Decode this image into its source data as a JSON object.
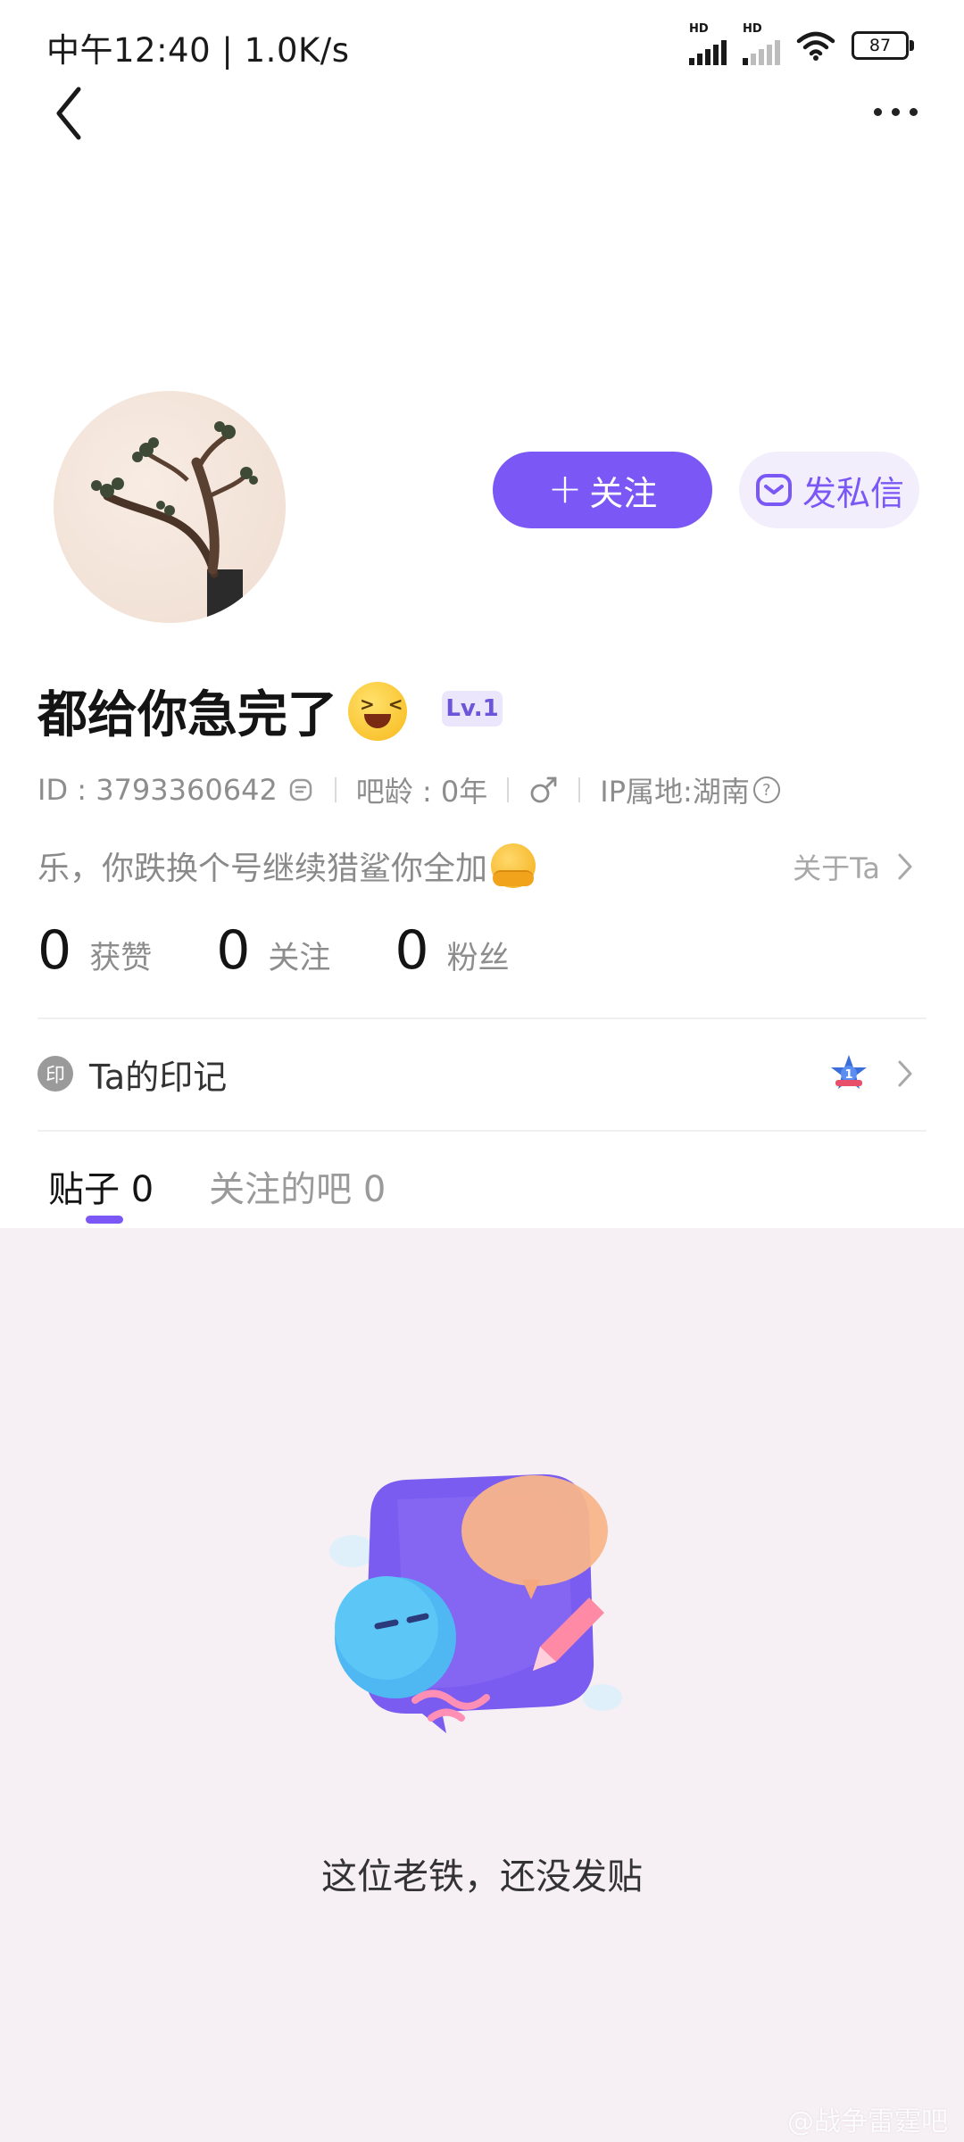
{
  "status_bar": {
    "time": "中午12:40",
    "speed": "1.0K/s",
    "signal_label_1": "HD",
    "signal_label_2": "HD",
    "battery": "87"
  },
  "nav": {
    "back_icon": "chevron-left-icon",
    "more_icon": "more-horizontal-icon"
  },
  "profile": {
    "follow_plus": "+",
    "follow_label": "关注",
    "message_label": "发私信",
    "username": "都给你急完了",
    "username_emoji": "laughing-emoji",
    "level": "Lv.1",
    "id_text": "ID : 3793360642",
    "bar_age": "吧龄 : 0年",
    "gender_icon": "male-icon",
    "ip_location": "IP属地:湖南",
    "help_mark": "?",
    "bio": "乐，你跌换个号继续猎鲨你全加",
    "bio_emoji": "hugging-emoji",
    "about_label": "关于Ta"
  },
  "stats": [
    {
      "num": "0",
      "label": "获赞"
    },
    {
      "num": "0",
      "label": "关注"
    },
    {
      "num": "0",
      "label": "粉丝"
    }
  ],
  "seal": {
    "icon_text": "印",
    "label": "Ta的印记",
    "badge_icon": "star-badge-icon",
    "badge_text": "1"
  },
  "tabs": [
    {
      "label": "贴子",
      "count": "0",
      "active": true
    },
    {
      "label": "关注的吧",
      "count": "0",
      "active": false
    }
  ],
  "empty_state": {
    "message": "这位老铁，还没发贴",
    "illustration": "empty-posts-illustration"
  },
  "watermark": "@战争雷霆吧",
  "colors": {
    "accent": "#7b58f5",
    "accent_light": "#f2eefc",
    "content_bg": "#f6eff4"
  }
}
